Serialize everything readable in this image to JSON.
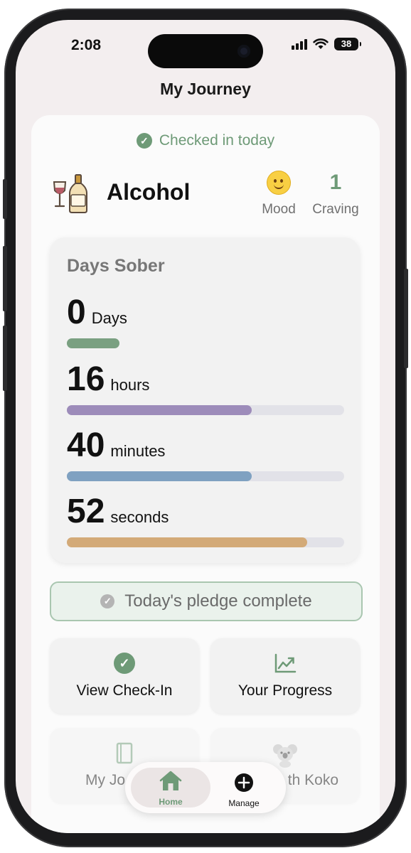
{
  "status_bar": {
    "time": "2:08",
    "battery": "38"
  },
  "header": {
    "title": "My Journey"
  },
  "checkin": {
    "status": "Checked in today"
  },
  "habit": {
    "title": "Alcohol",
    "mood_label": "Mood",
    "craving_value": "1",
    "craving_label": "Craving"
  },
  "sober": {
    "title": "Days Sober",
    "rows": [
      {
        "value": "0",
        "unit": "Days",
        "progress": 0.19,
        "color": "#7aa081"
      },
      {
        "value": "16",
        "unit": "hours",
        "progress": 0.667,
        "color": "#9d8cba"
      },
      {
        "value": "40",
        "unit": "minutes",
        "progress": 0.667,
        "color": "#7fa1c1"
      },
      {
        "value": "52",
        "unit": "seconds",
        "progress": 0.867,
        "color": "#d3aa78"
      }
    ]
  },
  "pledge": {
    "text": "Today's pledge complete"
  },
  "actions": {
    "view_checkin": "View Check-In",
    "your_progress": "Your Progress",
    "my_journal": "My Jo",
    "chat_koko": "th Koko"
  },
  "tabs": {
    "home": "Home",
    "manage": "Manage"
  },
  "colors": {
    "accent_green": "#6e9a77",
    "background": "#f3eeef"
  }
}
